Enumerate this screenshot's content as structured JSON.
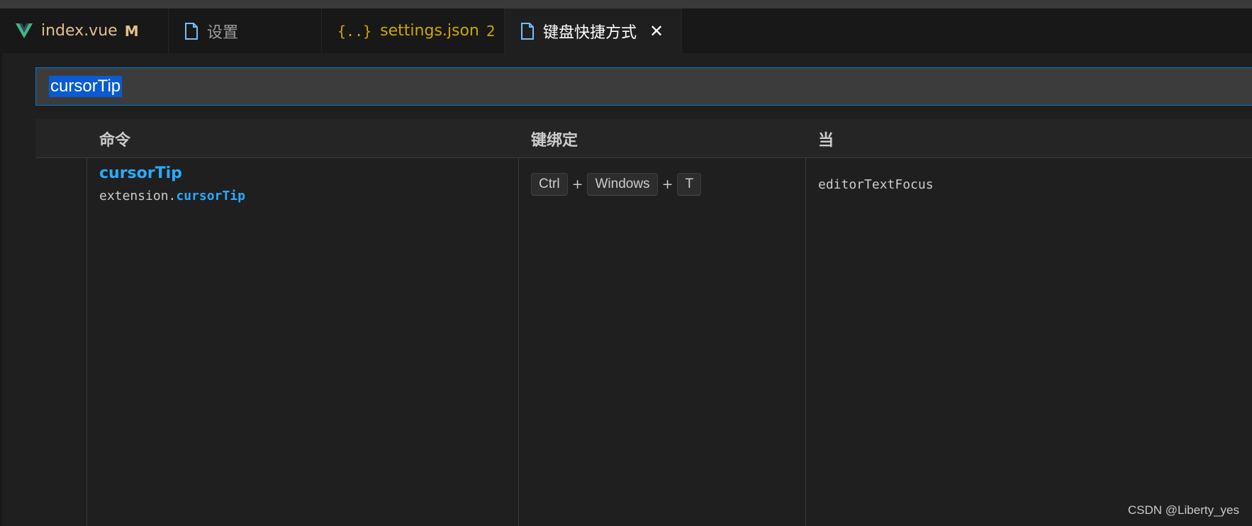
{
  "tabs": [
    {
      "label": "index.vue",
      "badge": "M",
      "icon": "vue-icon"
    },
    {
      "label": "设置",
      "icon": "file-icon"
    },
    {
      "label": "settings.json",
      "badge": "2",
      "icon": "json-braces-icon",
      "dirty": true
    },
    {
      "label": "键盘快捷方式",
      "icon": "file-icon",
      "active": true
    }
  ],
  "search": {
    "value": "cursorTip"
  },
  "table": {
    "headers": {
      "command": "命令",
      "keybinding": "键绑定",
      "when": "当"
    },
    "rows": [
      {
        "title": "cursorTip",
        "id_prefix": "extension.",
        "id_highlight": "cursorTip",
        "keys": [
          "Ctrl",
          "Windows",
          "T"
        ],
        "separator": "+",
        "when": "editorTextFocus"
      }
    ]
  },
  "watermark": "CSDN @Liberty_yes",
  "colors": {
    "accent": "#0078d4",
    "link": "#2aaaff",
    "vue": "#41b883",
    "json": "#cca700",
    "modified": "#e2c08d"
  }
}
